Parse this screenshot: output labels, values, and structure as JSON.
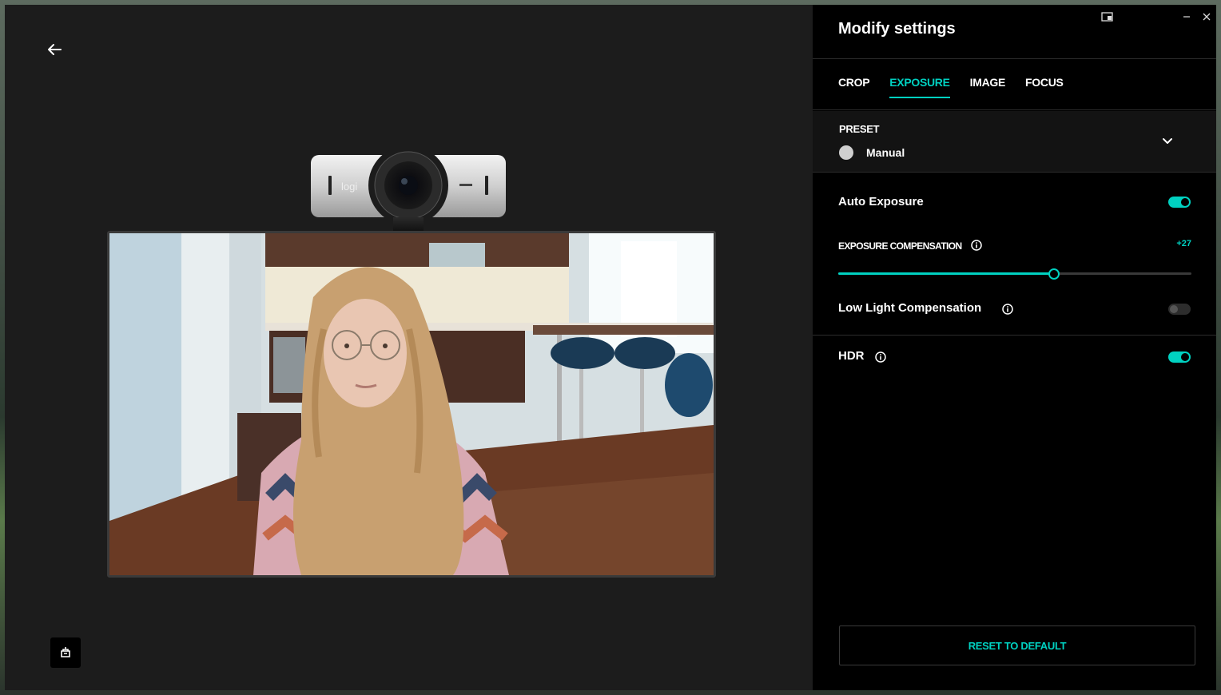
{
  "panel": {
    "title": "Modify settings",
    "tabs": [
      {
        "label": "CROP",
        "active": false
      },
      {
        "label": "EXPOSURE",
        "active": true
      },
      {
        "label": "IMAGE",
        "active": false
      },
      {
        "label": "FOCUS",
        "active": false
      }
    ],
    "preset": {
      "label": "PRESET",
      "value": "Manual"
    },
    "auto_exposure": {
      "label": "Auto Exposure",
      "enabled": true
    },
    "exposure_compensation": {
      "label": "EXPOSURE COMPENSATION",
      "value_text": "+27",
      "level_fraction": 0.61
    },
    "low_light": {
      "label": "Low Light Compensation",
      "enabled": false
    },
    "hdr": {
      "label": "HDR",
      "enabled": true
    },
    "reset_label": "RESET TO DEFAULT"
  },
  "camera": {
    "brand": "logi"
  },
  "colors": {
    "accent": "#00d1c1",
    "panel_bg": "#000000",
    "preview_bg": "#1c1c1c"
  },
  "icons": [
    "back-arrow-icon",
    "snap-window-icon",
    "minimize-icon",
    "close-icon",
    "chevron-down-icon",
    "info-icon",
    "bottom-device-icon"
  ]
}
